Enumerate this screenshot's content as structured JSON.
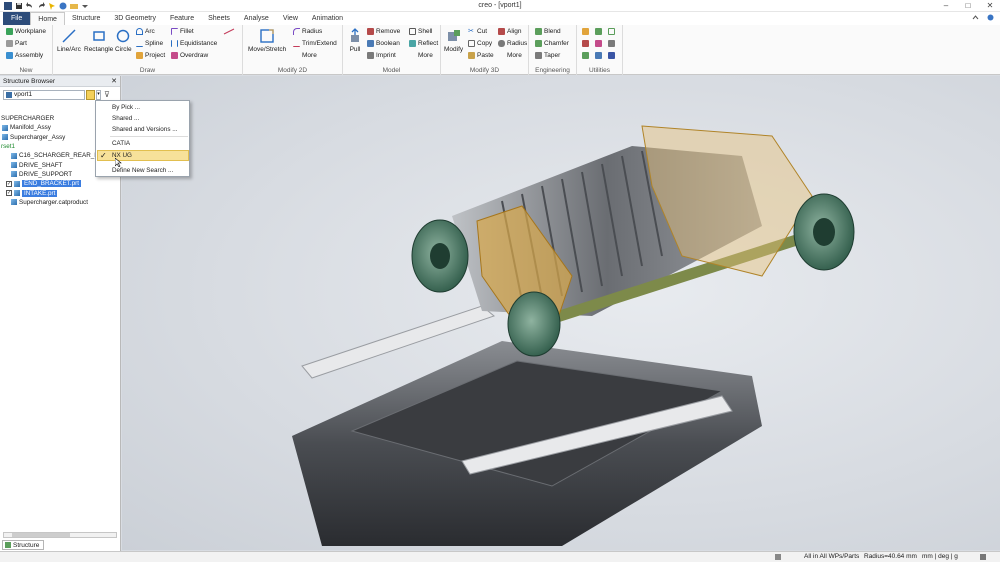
{
  "title": "creo - [vport1]",
  "tabs": [
    "File",
    "Home",
    "Structure",
    "3D Geometry",
    "Feature",
    "Sheets",
    "Analyse",
    "View",
    "Animation"
  ],
  "ribbon": {
    "new": {
      "label": "New",
      "items": [
        "Workplane",
        "Part",
        "Assembly"
      ]
    },
    "draw": {
      "label": "Draw",
      "line_arc": "Line/Arc",
      "rectangle": "Rectangle",
      "circle": "Circle",
      "arc": "Arc",
      "spline": "Spline",
      "project": "Project",
      "fillet": "Fillet",
      "equidistance": "Equidistance",
      "overdraw": "Overdraw"
    },
    "modify2d": {
      "label": "Modify 2D",
      "move_stretch": "Move/Stretch",
      "radius": "Radius",
      "trim_extend": "Trim/Extend",
      "more": "More"
    },
    "model": {
      "label": "Model",
      "pull": "Pull",
      "remove": "Remove",
      "boolean": "Boolean",
      "imprint": "Imprint",
      "shell": "Shell",
      "reflect": "Reflect",
      "more": "More"
    },
    "modify3d": {
      "label": "Modify 3D",
      "modify": "Modify",
      "cut": "Cut",
      "copy": "Copy",
      "paste": "Paste",
      "align": "Align",
      "radius": "Radius",
      "more": "More"
    },
    "engineering": {
      "label": "Engineering",
      "blend": "Blend",
      "chamfer": "Chamfer",
      "taper": "Taper"
    },
    "utilities": {
      "label": "Utilities"
    }
  },
  "panel": {
    "title": "Structure Browser",
    "search_value": "vport1",
    "tree": [
      {
        "label": "SUPERCHARGER",
        "kind": "root"
      },
      {
        "label": "Manifold_Assy",
        "kind": "asm"
      },
      {
        "label": "Supercharger_Assy",
        "kind": "asm"
      },
      {
        "label": "rset1",
        "kind": "set"
      },
      {
        "label": "C16_SCHARGER_REAR_INF",
        "kind": "part"
      },
      {
        "label": "DRIVE_SHAFT",
        "kind": "part"
      },
      {
        "label": "DRIVE_SUPPORT",
        "kind": "part"
      },
      {
        "label": "END_BRACKET.prt",
        "kind": "selected"
      },
      {
        "label": "INTAKE.prt",
        "kind": "selected"
      },
      {
        "label": "Supercharger.catproduct",
        "kind": "part"
      }
    ],
    "bottom_tab": "Structure"
  },
  "menu": {
    "items": [
      "By Pick ...",
      "Shared ...",
      "Shared and Versions ...",
      "CATIA",
      "NX UG",
      "Define New Search ..."
    ],
    "checked": "NX UG"
  },
  "status": {
    "scope": "All in All WPs/Parts",
    "radius": "Radius=40.64 mm",
    "units": "mm | deg | g"
  }
}
